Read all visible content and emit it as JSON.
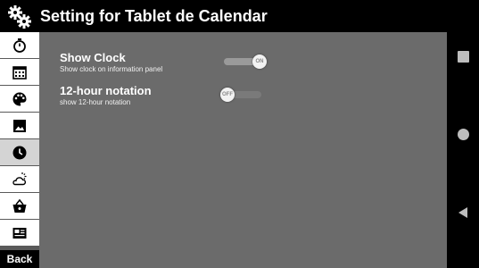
{
  "window": {
    "title": "Setting for Tablet de Calendar",
    "icon": "gear-icon"
  },
  "sidebar": {
    "items": [
      {
        "icon": "timer-icon",
        "active": false
      },
      {
        "icon": "calendar-icon",
        "active": false
      },
      {
        "icon": "palette-icon",
        "active": false
      },
      {
        "icon": "image-icon",
        "active": false
      },
      {
        "icon": "clock-icon",
        "active": true
      },
      {
        "icon": "weather-icon",
        "active": false
      },
      {
        "icon": "basket-icon",
        "active": false
      },
      {
        "icon": "news-icon",
        "active": false
      }
    ],
    "back_label": "Back"
  },
  "settings": {
    "show_clock": {
      "title": "Show Clock",
      "description": "Show clock on information panel",
      "toggle_state": "ON",
      "enabled": true
    },
    "hour12": {
      "title": "12-hour notation",
      "description": "show 12-hour notation",
      "toggle_state": "OFF",
      "enabled": false
    }
  },
  "navbar": {
    "buttons": [
      "recents-button",
      "home-button",
      "back-button"
    ]
  },
  "colors": {
    "titlebar": "#000000",
    "content_bg": "#6b6b6b",
    "sidebar_item_bg": "#ffffff",
    "sidebar_active_bg": "#d4d4d4"
  }
}
